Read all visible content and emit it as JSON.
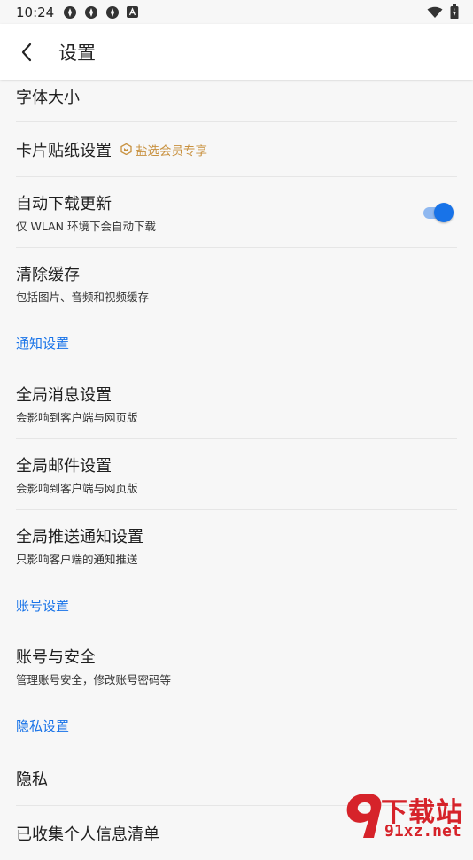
{
  "status_bar": {
    "time": "10:24"
  },
  "header": {
    "title": "设置"
  },
  "settings": {
    "font_size": {
      "title": "字体大小"
    },
    "card_sticker": {
      "title": "卡片贴纸设置",
      "badge": "盐选会员专享"
    },
    "auto_update": {
      "title": "自动下载更新",
      "subtitle": "仅 WLAN 环境下会自动下载",
      "toggle_on": true
    },
    "clear_cache": {
      "title": "清除缓存",
      "subtitle": "包括图片、音频和视频缓存"
    }
  },
  "notification_section": {
    "header": "通知设置",
    "global_message": {
      "title": "全局消息设置",
      "subtitle": "会影响到客户端与网页版"
    },
    "global_mail": {
      "title": "全局邮件设置",
      "subtitle": "会影响到客户端与网页版"
    },
    "global_push": {
      "title": "全局推送通知设置",
      "subtitle": "只影响客户端的通知推送"
    }
  },
  "account_section": {
    "header": "账号设置",
    "account_security": {
      "title": "账号与安全",
      "subtitle": "管理账号安全，修改账号密码等"
    }
  },
  "privacy_section": {
    "header": "隐私设置",
    "privacy": {
      "title": "隐私"
    },
    "personal_info_list": {
      "title": "已收集个人信息清单"
    }
  },
  "watermark": {
    "brand": "下载站",
    "url": "91xz.net"
  },
  "colors": {
    "accent": "#1873e8",
    "badge": "#c8913f",
    "watermark": "#d6232a"
  }
}
